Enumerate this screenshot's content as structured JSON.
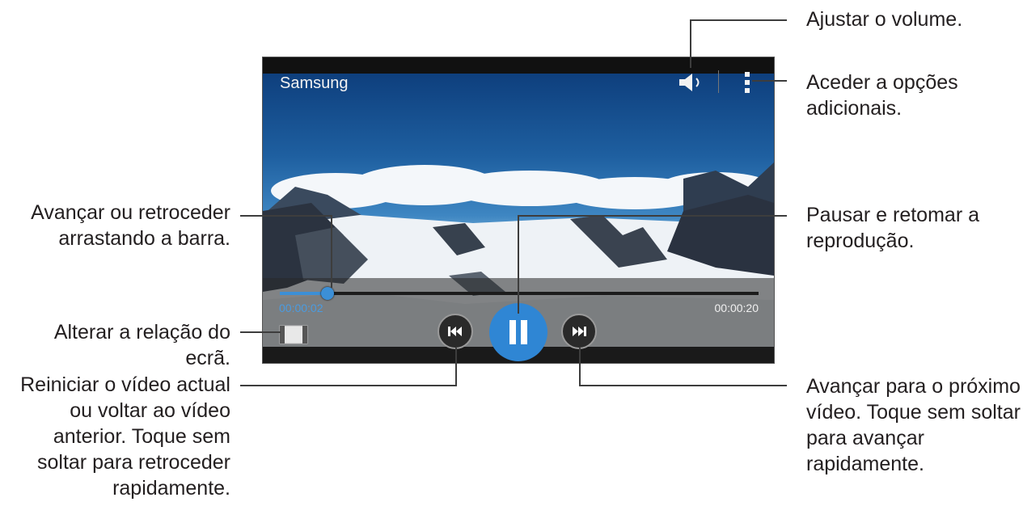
{
  "player": {
    "title": "Samsung",
    "current_time": "00:00:02",
    "total_time": "00:00:20",
    "progress_fraction": 0.1,
    "accent_color": "#3c8fd6"
  },
  "icons": {
    "volume": "volume-icon",
    "more": "more-options-icon",
    "ratio": "screen-ratio-icon",
    "previous": "skip-previous-icon",
    "pause": "pause-icon",
    "next": "skip-next-icon"
  },
  "callouts": {
    "volume": "Ajustar o volume.",
    "options": "Aceder a opções adicionais.",
    "seek": "Avançar ou retroceder arrastando a barra.",
    "pause": "Pausar e retomar a reprodução.",
    "ratio": "Alterar a relação do ecrã.",
    "previous": "Reiniciar o vídeo actual ou voltar ao vídeo anterior. Toque sem soltar para retroceder rapidamente.",
    "next": "Avançar para o próximo vídeo. Toque sem soltar para avançar rapidamente."
  }
}
